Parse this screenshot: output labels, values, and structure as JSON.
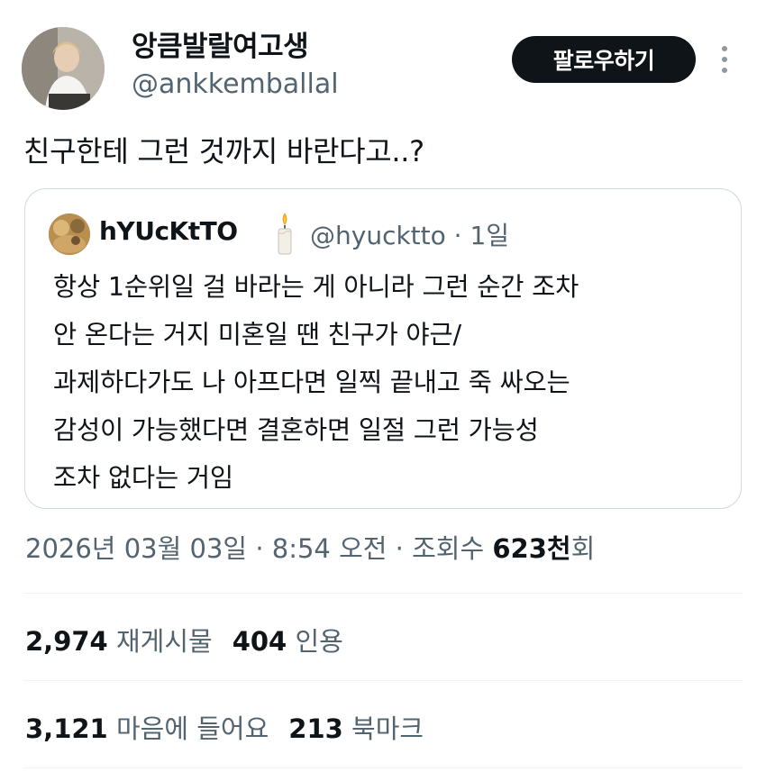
{
  "author": {
    "display_name": "앙큼발랄여고생",
    "handle": "@ankkemballal"
  },
  "follow_button_label": "팔로우하기",
  "tweet_text": "친구한테 그런 것까지 바란다고..?",
  "quote": {
    "display_name": "hYUcKtTO",
    "handle": "@hyucktto",
    "time": "· 1일",
    "lines": [
      "항상 1순위일 걸 바라는 게 아니라 그런 순간 조차",
      "안 온다는 거지 미혼일 땐 친구가 야근/",
      "과제하다가도 나 아프다면 일찍 끝내고 죽 싸오는",
      "감성이 가능했다면 결혼하면 일절 그런 가능성",
      "조차 없다는 거임"
    ]
  },
  "meta": {
    "date": "2026년 03월 03일",
    "time": "· 8:54 오전 ·",
    "views_label": "조회수",
    "views_count": "623천",
    "views_suffix": "회"
  },
  "stats": {
    "retweets_count": "2,974",
    "retweets_label": "재게시물",
    "quotes_count": "404",
    "quotes_label": "인용",
    "likes_count": "3,121",
    "likes_label": "마음에 들어요",
    "bookmarks_count": "213",
    "bookmarks_label": "북마크"
  }
}
